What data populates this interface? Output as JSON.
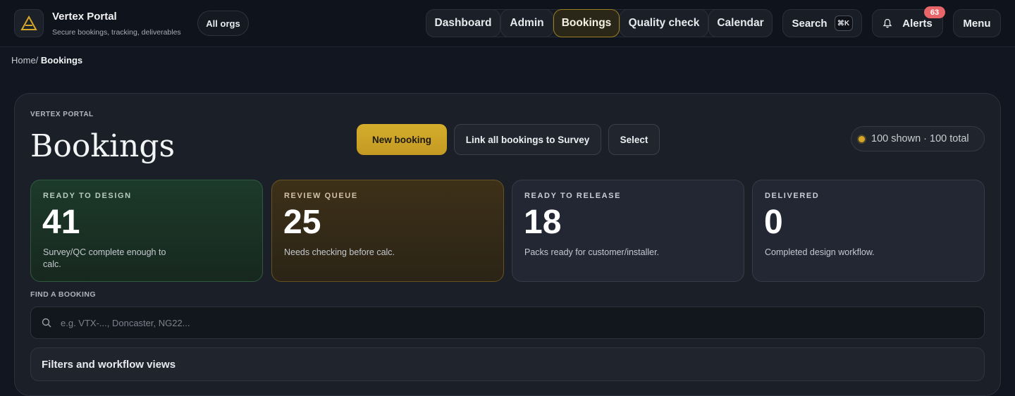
{
  "brand": {
    "title": "Vertex Portal",
    "subtitle": "Secure bookings, tracking, deliverables",
    "org_selector": "All orgs"
  },
  "nav": {
    "items": [
      {
        "label": "Dashboard",
        "active": false
      },
      {
        "label": "Admin",
        "active": false
      },
      {
        "label": "Bookings",
        "active": true
      },
      {
        "label": "Quality check",
        "active": false
      },
      {
        "label": "Calendar",
        "active": false
      }
    ],
    "search_label": "Search",
    "search_shortcut": "⌘K",
    "alerts_label": "Alerts",
    "alerts_count": "63",
    "menu_label": "Menu"
  },
  "breadcrumb": {
    "home": "Home/",
    "current": "Bookings"
  },
  "page": {
    "eyebrow": "VERTEX PORTAL",
    "title": "Bookings",
    "actions": {
      "new_booking": "New booking",
      "link_all": "Link all bookings to Survey",
      "select": "Select"
    },
    "count_text": "100 shown · 100 total"
  },
  "cards": [
    {
      "label": "READY TO DESIGN",
      "value": "41",
      "desc": "Survey/QC complete enough to calc."
    },
    {
      "label": "REVIEW QUEUE",
      "value": "25",
      "desc": "Needs checking before calc."
    },
    {
      "label": "READY TO RELEASE",
      "value": "18",
      "desc": "Packs ready for customer/installer."
    },
    {
      "label": "DELIVERED",
      "value": "0",
      "desc": "Completed design workflow."
    }
  ],
  "search": {
    "label": "FIND A BOOKING",
    "placeholder": "e.g. VTX-..., Doncaster, NG22...",
    "value": ""
  },
  "filters": {
    "label": "Filters and workflow views"
  },
  "colors": {
    "accent": "#d4ad2c",
    "alert_badge": "#e8666a",
    "background": "#111620"
  }
}
